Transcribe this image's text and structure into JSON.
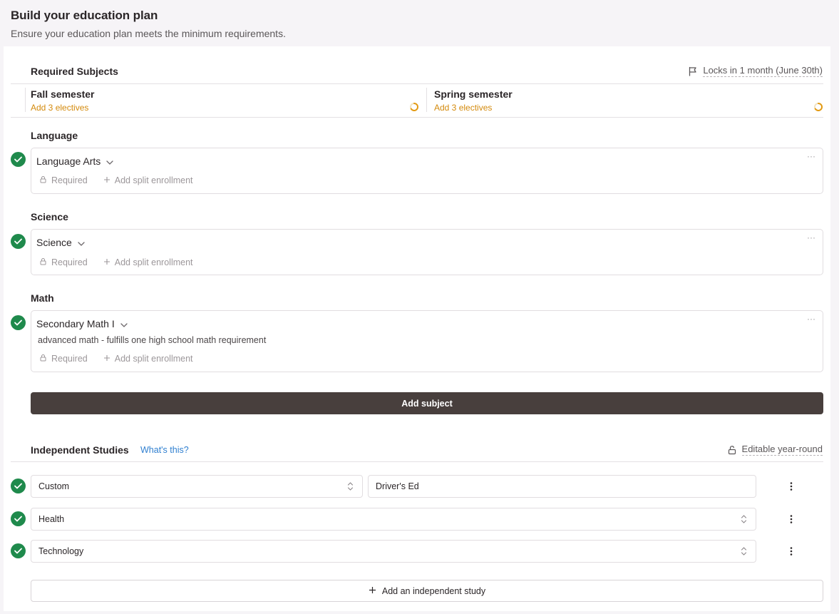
{
  "header": {
    "title": "Build your education plan",
    "subtitle": "Ensure your education plan meets the minimum requirements."
  },
  "required": {
    "title": "Required Subjects",
    "lock_note": "Locks in 1 month (June 30th)",
    "semesters": [
      {
        "title": "Fall semester",
        "status": "Add 3 electives"
      },
      {
        "title": "Spring semester",
        "status": "Add 3 electives"
      }
    ],
    "groups": [
      {
        "heading": "Language",
        "subject": "Language Arts",
        "description": "",
        "required_label": "Required",
        "split_label": "Add split enrollment"
      },
      {
        "heading": "Science",
        "subject": "Science",
        "description": "",
        "required_label": "Required",
        "split_label": "Add split enrollment"
      },
      {
        "heading": "Math",
        "subject": "Secondary Math I",
        "description": "advanced math - fulfills one high school math requirement",
        "required_label": "Required",
        "split_label": "Add split enrollment"
      }
    ],
    "add_subject_label": "Add subject"
  },
  "independent": {
    "title": "Independent Studies",
    "help_link": "What's this?",
    "edit_note": "Editable year-round",
    "rows": [
      {
        "type": "Custom",
        "name": "Driver's Ed"
      },
      {
        "type": "Health"
      },
      {
        "type": "Technology"
      }
    ],
    "add_label": "Add an independent study"
  },
  "colors": {
    "accent_green": "#1f8a4c",
    "warning_orange": "#d48a0c",
    "button_dark": "#483f3d",
    "link_blue": "#2f7fd0"
  }
}
